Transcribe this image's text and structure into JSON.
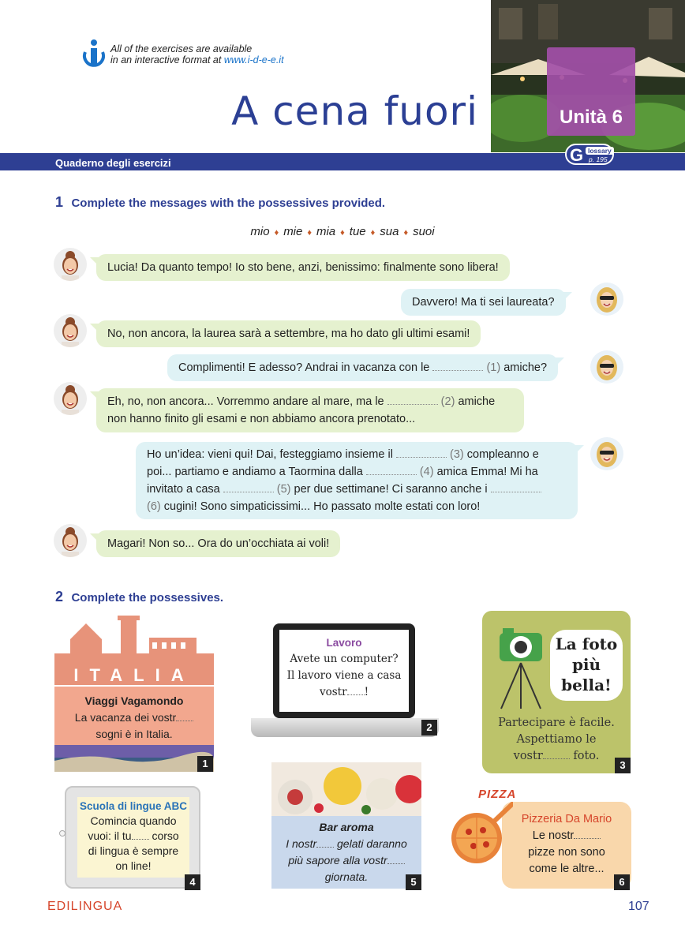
{
  "header": {
    "info_line1": "All of the exercises are available",
    "info_line2": "in an interactive format at ",
    "info_url": "www.i-d-e-e.it",
    "title": "A cena fuori",
    "unit": "Unità 6",
    "band": "Quaderno degli esercizi",
    "glossary_letter": "G",
    "glossary_word": "lossary",
    "glossary_page": "p. 195"
  },
  "exercise1": {
    "number": "1",
    "instruction": "Complete the messages with the possessives provided.",
    "words": [
      "mio",
      "mie",
      "mia",
      "tue",
      "sua",
      "suoi"
    ],
    "messages": [
      {
        "speaker": "left",
        "parts": [
          "Lucia! Da quanto tempo! Io sto bene, anzi, benissimo: finalmente sono libera!"
        ]
      },
      {
        "speaker": "right",
        "parts": [
          "Davvero! Ma ti sei laureata?"
        ]
      },
      {
        "speaker": "left",
        "parts": [
          "No, non ancora, la laurea sarà a settembre, ma ho dato gli ultimi esami!"
        ]
      },
      {
        "speaker": "right",
        "parts": [
          "Complimenti! E adesso? Andrai in vacanza con le",
          "(1)",
          "amiche?"
        ]
      },
      {
        "speaker": "left",
        "parts": [
          "Eh, no, non ancora... Vorremmo andare al mare, ma le",
          "(2)",
          "amiche",
          "non hanno finito gli esami e non abbiamo ancora prenotato..."
        ]
      },
      {
        "speaker": "right",
        "parts": [
          "Ho un’idea: vieni qui! Dai, festeggiamo insieme il",
          "(3)",
          "compleanno e",
          "poi... partiamo e andiamo a Taormina dalla",
          "(4)",
          "amica Emma! Mi ha",
          "invitato a casa",
          "(5)",
          "per due settimane! Ci saranno anche i",
          "(6)",
          "cugini! Sono simpaticissimi... Ho passato molte estati con loro!"
        ]
      },
      {
        "speaker": "left",
        "parts": [
          "Magari! Non so... Ora do un’occhiata ai voli!"
        ]
      }
    ]
  },
  "exercise2": {
    "number": "2",
    "instruction": "Complete the possessives.",
    "cards": [
      {
        "n": "1",
        "banner": "ITALIA",
        "title": "Viaggi Vagamondo",
        "l1a": "La vacanza dei vostr",
        "l2": "sogni è in Italia."
      },
      {
        "n": "2",
        "title": "Lavoro",
        "l1": "Avete un computer?",
        "l2": "Il lavoro viene a casa",
        "l3a": "vostr",
        "l3b": "!"
      },
      {
        "n": "3",
        "badge1": "La foto",
        "badge2": "più",
        "badge3": "bella!",
        "l1": "Partecipare è facile.",
        "l2": "Aspettiamo le",
        "l3a": "vostr",
        "l3b": "foto."
      },
      {
        "n": "4",
        "title": "Scuola di lingue ABC",
        "l1": "Comincia quando",
        "l2a": "vuoi: il tu",
        "l2b": "corso",
        "l3": "di lingua è sempre",
        "l4": "on line!"
      },
      {
        "n": "5",
        "title": "Bar aroma",
        "l1a": "I nostr",
        "l1b": "gelati daranno",
        "l2a": "più sapore alla vostr",
        "l3": "giornata."
      },
      {
        "n": "6",
        "sign": "PIZZA",
        "title": "Pizzeria Da Mario",
        "l1a": "Le nostr",
        "l2": "pizze non sono",
        "l3": "come le altre..."
      }
    ]
  },
  "footer": {
    "publisher": "EDILINGUA",
    "page": "107"
  },
  "colors": {
    "primary": "#2e3f93",
    "unit": "#a24fa8",
    "green_bubble": "#e5f1cf",
    "blue_bubble": "#dff2f5",
    "accent": "#d6452b"
  }
}
